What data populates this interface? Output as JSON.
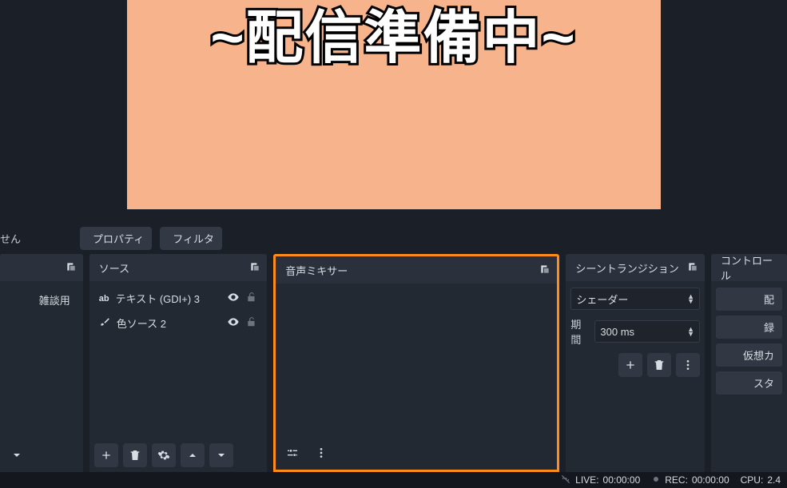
{
  "preview": {
    "overlay_text": "~配信準備中~"
  },
  "toolbar": {
    "left_text": "せん",
    "properties_label": "プロパティ",
    "filters_label": "フィルタ"
  },
  "docks": {
    "scenes": {
      "title": "",
      "items": [
        {
          "label": "雑談用"
        }
      ]
    },
    "sources": {
      "title": "ソース",
      "items": [
        {
          "icon": "text-icon",
          "label": "テキスト (GDI+) 3",
          "visible": true,
          "locked": false
        },
        {
          "icon": "brush-icon",
          "label": "色ソース 2",
          "visible": true,
          "locked": false
        }
      ]
    },
    "mixer": {
      "title": "音声ミキサー"
    },
    "transitions": {
      "title": "シーントランジション",
      "selected": "シェーダー",
      "duration_label": "期間",
      "duration_value": "300 ms"
    },
    "controls": {
      "title": "コントロール",
      "buttons": [
        {
          "label": "配"
        },
        {
          "label": "録"
        },
        {
          "label": "仮想カ"
        },
        {
          "label": "スタ"
        }
      ]
    }
  },
  "status": {
    "live_label": "LIVE:",
    "live_time": "00:00:00",
    "rec_label": "REC:",
    "rec_time": "00:00:00",
    "cpu_label": "CPU:",
    "cpu_value": "2.4"
  }
}
